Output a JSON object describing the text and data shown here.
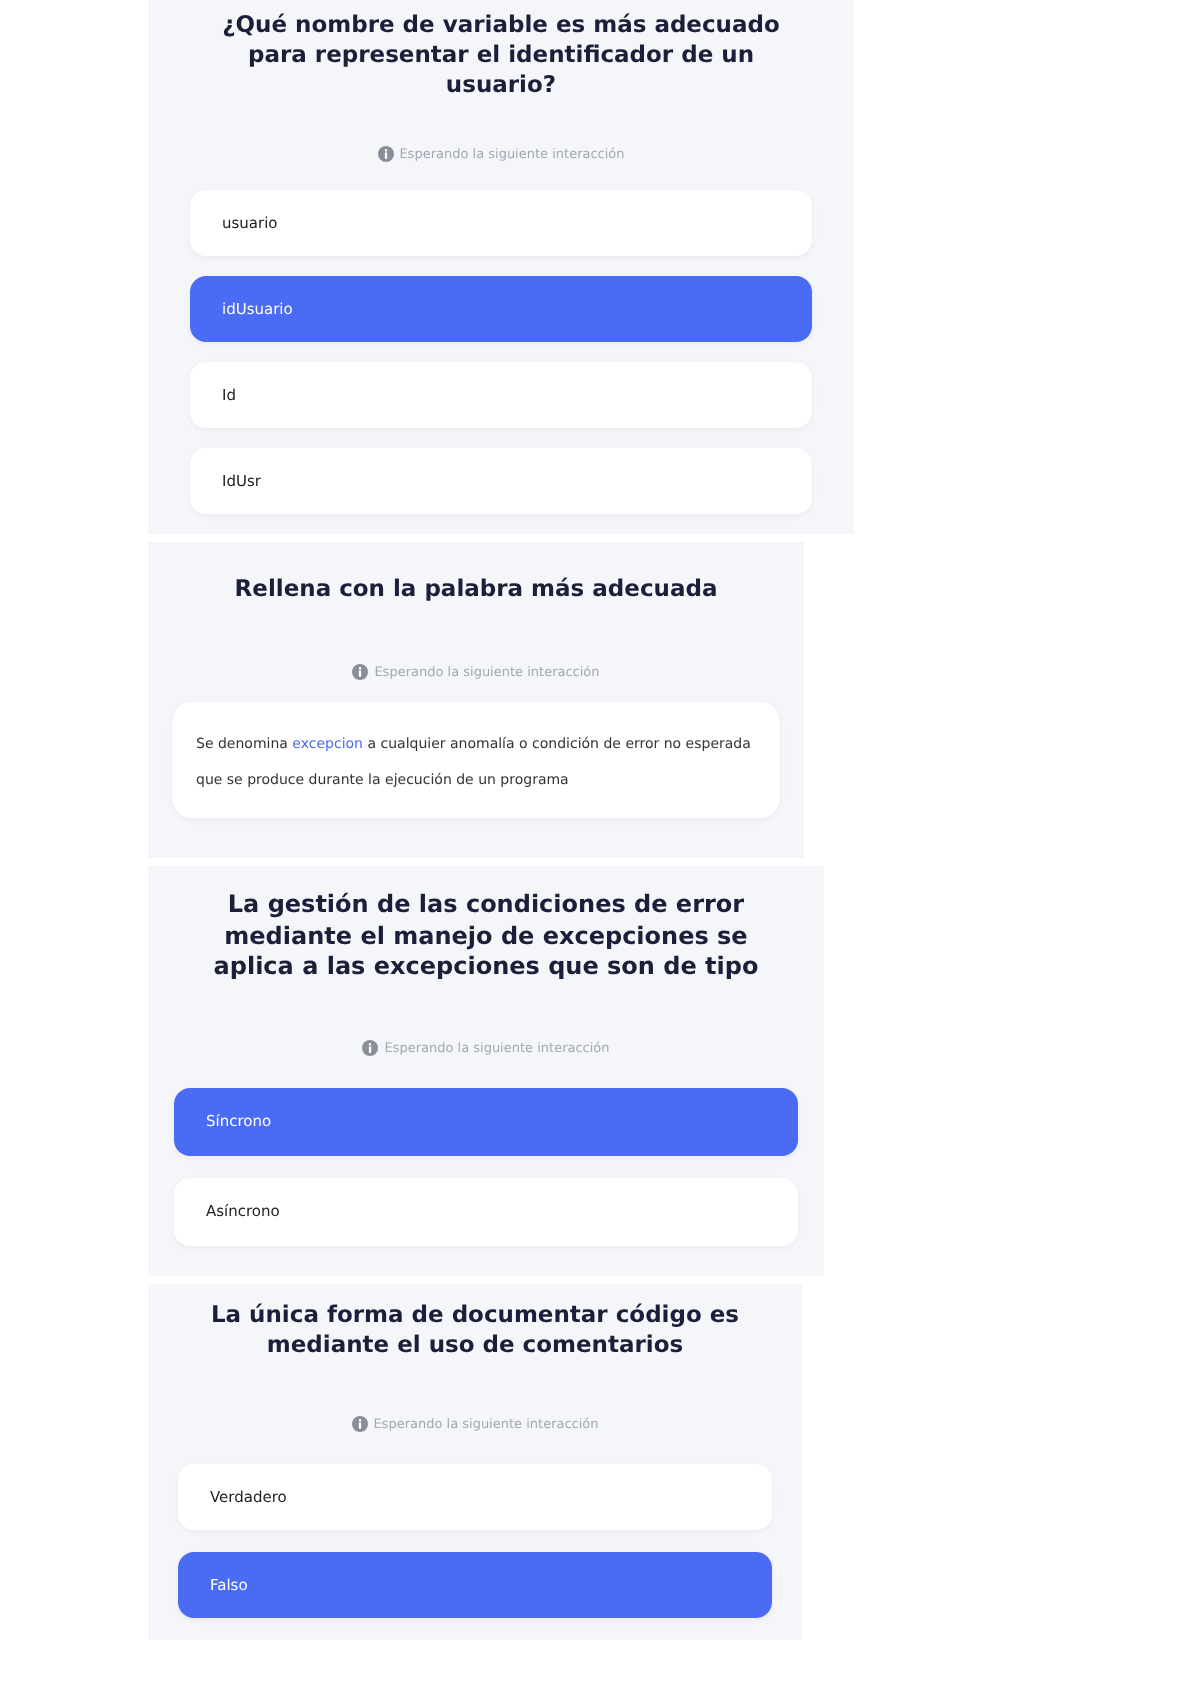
{
  "cards": [
    {
      "kind": "choice",
      "title": "¿Qué nombre de variable es más adecuado para representar el identificador de un usuario?",
      "status": "Esperando la siguiente interacción",
      "options": [
        {
          "label": "usuario",
          "selected": false
        },
        {
          "label": "idUsuario",
          "selected": true
        },
        {
          "label": "Id",
          "selected": false
        },
        {
          "label": "IdUsr",
          "selected": false
        }
      ]
    },
    {
      "kind": "fill",
      "title": "Rellena con la palabra más adecuada",
      "status": "Esperando la siguiente interacción",
      "sentence": {
        "before": "Se denomina",
        "blank": "excepcion",
        "after": "a cualquier anomalía o condición de error no esperada que se produce durante la ejecución de un programa"
      }
    },
    {
      "kind": "choice",
      "title": "La gestión de las condiciones de error mediante el manejo de excepciones se aplica a las excepciones que son de tipo",
      "status": "Esperando la siguiente interacción",
      "options": [
        {
          "label": "Síncrono",
          "selected": true
        },
        {
          "label": "Asíncrono",
          "selected": false
        }
      ]
    },
    {
      "kind": "choice",
      "title": "La única forma de documentar código es mediante el uso de comentarios",
      "status": "Esperando la siguiente interacción",
      "options": [
        {
          "label": "Verdadero",
          "selected": false
        },
        {
          "label": "Falso",
          "selected": true
        }
      ]
    }
  ]
}
